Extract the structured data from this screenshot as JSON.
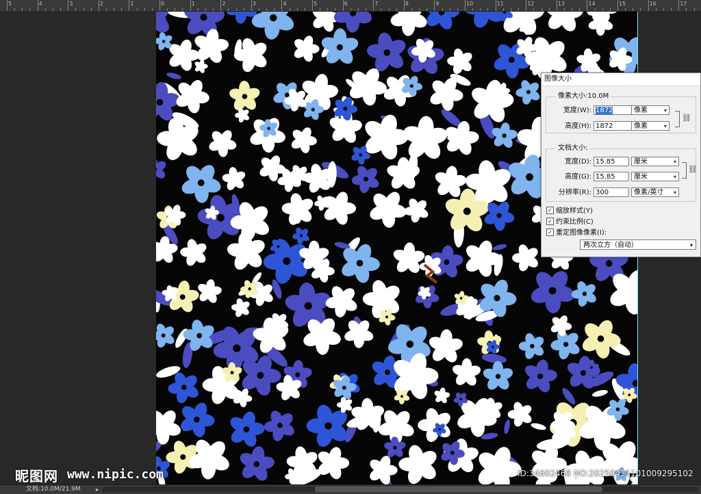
{
  "ruler": {
    "labels": [
      "5",
      "4",
      "3",
      "2",
      "1",
      "0",
      "1",
      "2",
      "3",
      "4",
      "5",
      "6",
      "7",
      "8",
      "9",
      "10",
      "11",
      "12",
      "13",
      "14",
      "15",
      "16",
      "17"
    ]
  },
  "dialog": {
    "title": "图像大小",
    "pixel_group_title": "像素大小:10.0M",
    "doc_group_title": "文档大小:",
    "width_px": {
      "label": "宽度(W):",
      "value": "1872",
      "unit": "像素"
    },
    "height_px": {
      "label": "高度(H):",
      "value": "1872",
      "unit": "像素"
    },
    "width_doc": {
      "label": "宽度(D):",
      "value": "15.85",
      "unit": "厘米"
    },
    "height_doc": {
      "label": "高度(G):",
      "value": "15.85",
      "unit": "厘米"
    },
    "resolution": {
      "label": "分辨率(R):",
      "value": "300",
      "unit": "像素/英寸"
    },
    "scale_styles": {
      "label": "缩放样式(Y)",
      "checked": true
    },
    "constrain": {
      "label": "约束比例(C)",
      "checked": true
    },
    "resample": {
      "label": "重定图像像素(I):",
      "checked": true
    },
    "resample_method": "两次立方（自动）"
  },
  "status": {
    "doc": "文档:10.0M/21.9M"
  },
  "watermark": {
    "logo": "昵图网",
    "url": "www.nipic.com",
    "id": "ID:34602468 NO:20250421101009295102"
  },
  "colors": {
    "canvas_bg": "#050505",
    "flower_white": "#ffffff",
    "flower_light_blue": "#7fb4ee",
    "flower_blue": "#2d55d6",
    "flower_indigo": "#4a4cc0",
    "flower_cream": "#f6f0b4",
    "accent_brown": "#8a3a10"
  },
  "icons": {
    "link": "chain-link-icon",
    "dropdown": "chevron-down-icon",
    "checkbox": "checkmark-icon"
  }
}
